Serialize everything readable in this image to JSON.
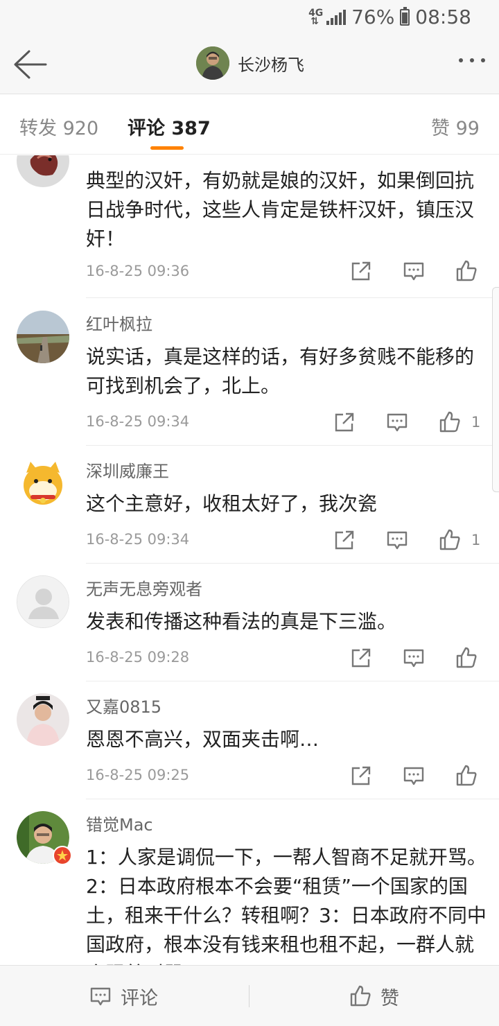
{
  "status_bar": {
    "network": "4G",
    "battery": "76%",
    "battery_level": 0.76,
    "time": "08:58"
  },
  "header": {
    "title": "长沙杨飞"
  },
  "tabs": {
    "repost": "转发 920",
    "comment": "评论 387",
    "likes": "赞 99"
  },
  "comments": [
    {
      "name": "",
      "text": "典型的汉奸，有奶就是娘的汉奸，如果倒回抗日战争时代，这些人肯定是铁杆汉奸，镇压汉奸！",
      "time": "16-8-25 09:36",
      "likes": ""
    },
    {
      "name": "红叶枫拉",
      "text": "说实话，真是这样的话，有好多贫贱不能移的可找到机会了，北上。",
      "time": "16-8-25 09:34",
      "likes": "1"
    },
    {
      "name": "深圳威廉王",
      "text": "这个主意好，收租太好了，我次瓷",
      "time": "16-8-25 09:34",
      "likes": "1"
    },
    {
      "name": "无声无息旁观者",
      "text": "发表和传播这种看法的真是下三滥。",
      "time": "16-8-25 09:28",
      "likes": ""
    },
    {
      "name": "又嘉0815",
      "text": "恩恩不高兴，双面夹击啊…",
      "time": "16-8-25 09:25",
      "likes": ""
    },
    {
      "name": "错觉Mac",
      "text": "1：人家是调侃一下，一帮人智商不足就开骂。2：日本政府根本不会要“租赁”一个国家的国土，租来干什么？转租啊？3：日本政府不同中国政府，根本没有钱来租也租不起，一群人就会跟着叫嚣",
      "time": "",
      "likes": ""
    }
  ],
  "bottom_bar": {
    "comment_label": "评论",
    "like_label": "赞"
  },
  "colors": {
    "accent": "#ff8200",
    "text": "#222222",
    "muted": "#9a9a9a",
    "bar": "#f7f7f7"
  },
  "icons": [
    "back-arrow-icon",
    "more-icon",
    "repost-icon",
    "comment-icon",
    "like-icon",
    "verified-badge-icon"
  ]
}
